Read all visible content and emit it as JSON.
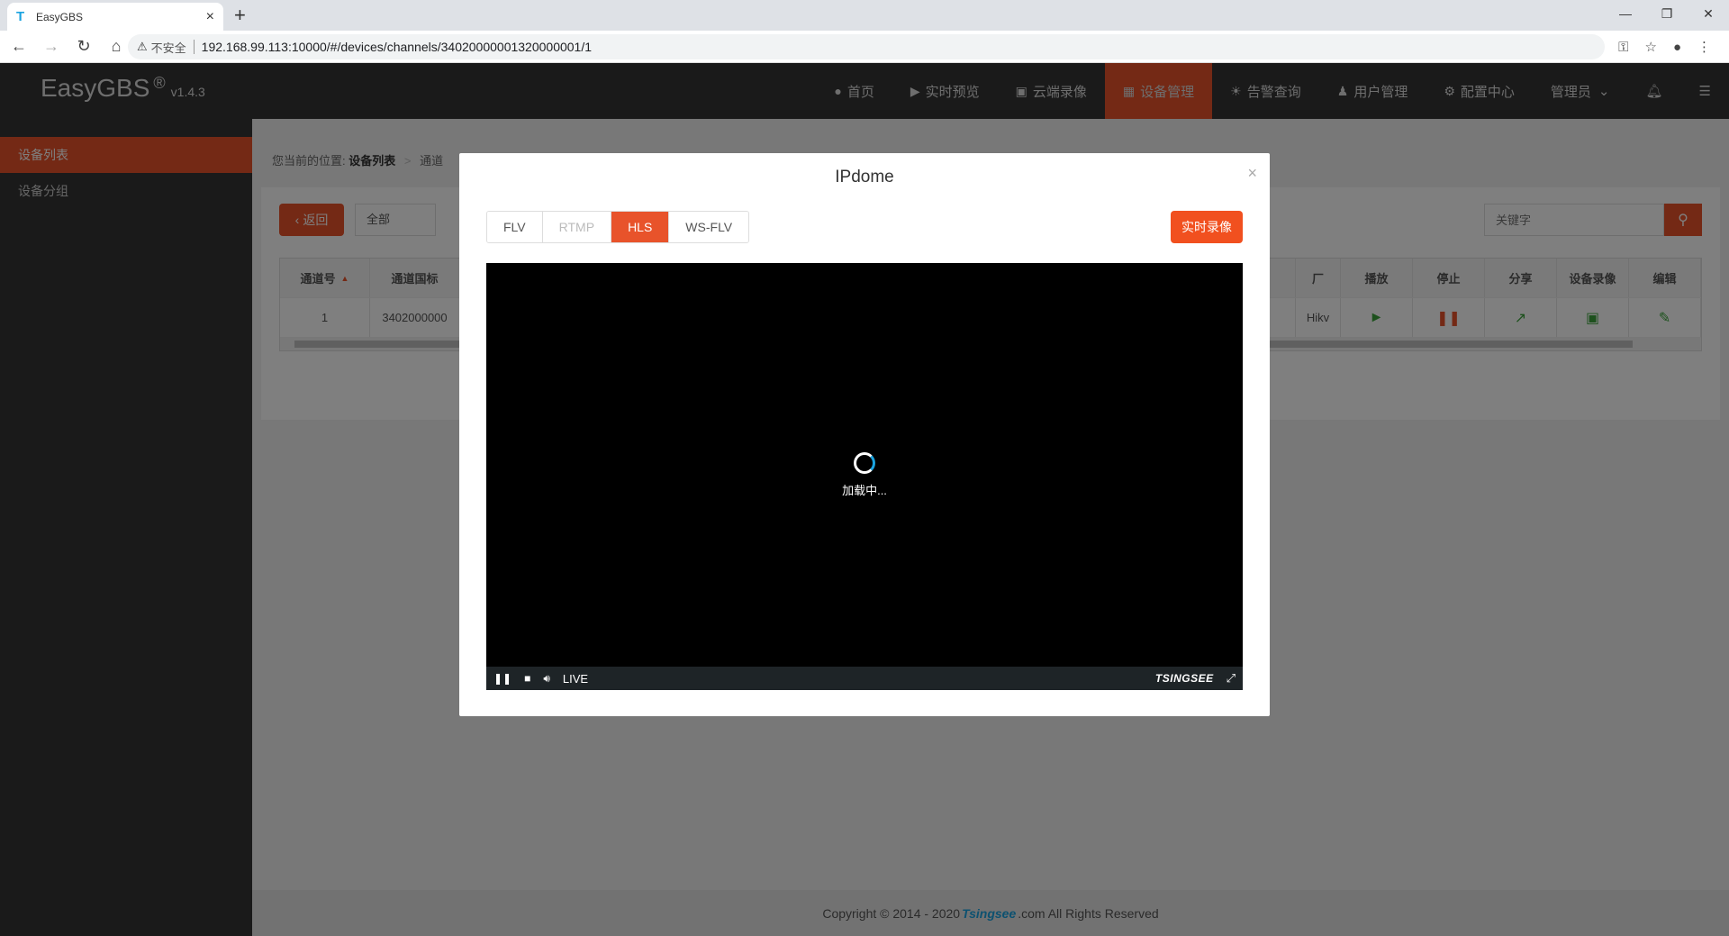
{
  "browser": {
    "tab_title": "EasyGBS",
    "insecure_label": "不安全",
    "url": "192.168.99.113:10000/#/devices/channels/34020000001320000001/1"
  },
  "app": {
    "logo": "EasyGBS",
    "reg": "®",
    "version": "v1.4.3",
    "nav": [
      {
        "label": "首页"
      },
      {
        "label": "实时预览"
      },
      {
        "label": "云端录像"
      },
      {
        "label": "设备管理"
      },
      {
        "label": "告警查询"
      },
      {
        "label": "用户管理"
      },
      {
        "label": "配置中心"
      },
      {
        "label": "管理员"
      }
    ],
    "sidebar": [
      {
        "label": "设备列表"
      },
      {
        "label": "设备分组"
      }
    ],
    "breadcrumb": {
      "prefix": "您当前的位置:",
      "current": "设备列表",
      "sep": ">",
      "next": "通道"
    },
    "back_label": "返回",
    "select_value": "全部",
    "keyword_placeholder": "关键字",
    "table": {
      "headers": [
        "通道号",
        "通道国标",
        "厂",
        "播放",
        "停止",
        "分享",
        "设备录像",
        "编辑"
      ],
      "row": {
        "channel": "1",
        "gb": "3402000000",
        "vendor": "Hikv"
      }
    },
    "footer": {
      "pre": "Copyright © 2014 - 2020 ",
      "brand": "Tsingsee",
      "post": ".com All Rights Reserved"
    }
  },
  "modal": {
    "title": "IPdome",
    "close": "×",
    "protocols": [
      "FLV",
      "RTMP",
      "HLS",
      "WS-FLV"
    ],
    "active_protocol": "HLS",
    "record_label": "实时录像",
    "loading": "加载中...",
    "live_label": "LIVE",
    "player_brand": "TSINGSEE"
  },
  "colors": {
    "accent": "#e8532b",
    "header": "#353535"
  }
}
